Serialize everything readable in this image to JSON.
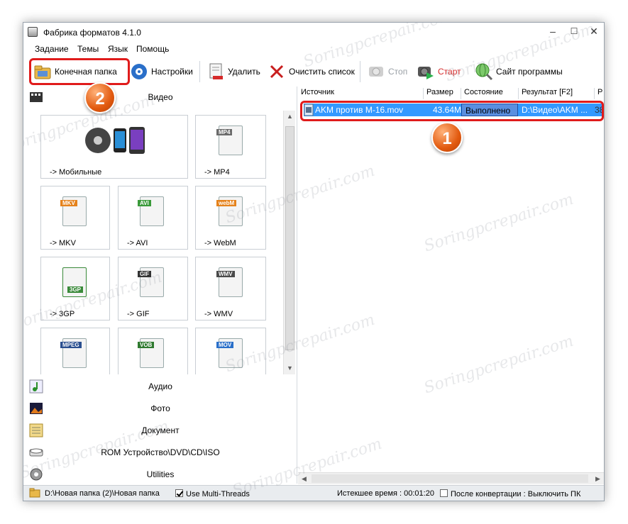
{
  "window": {
    "title": "Фабрика форматов 4.1.0",
    "controls": {
      "minimize": "–",
      "maximize": "☐",
      "close": "✕"
    }
  },
  "menu": [
    "Задание",
    "Темы",
    "Язык",
    "Помощь"
  ],
  "toolbar": {
    "output_folder": "Конечная папка",
    "settings": "Настройки",
    "delete": "Удалить",
    "clear_list": "Очистить список",
    "stop": "Стоп",
    "start": "Старт",
    "website": "Сайт программы"
  },
  "annotations": {
    "badge1": "1",
    "badge2": "2"
  },
  "categories": {
    "video": "Видео",
    "audio": "Аудио",
    "photo": "Фото",
    "document": "Документ",
    "rom": "ROM Устройство\\DVD\\CD\\ISO",
    "utilities": "Utilities"
  },
  "tiles": [
    {
      "label": "-> Мобильные",
      "tag": ""
    },
    {
      "label": "-> MP4",
      "tag": "MP4"
    },
    {
      "label": "-> MKV",
      "tag": "MKV"
    },
    {
      "label": "-> AVI",
      "tag": "AVI"
    },
    {
      "label": "-> WebM",
      "tag": "webM"
    },
    {
      "label": "-> 3GP",
      "tag": "3GP"
    },
    {
      "label": "-> GIF",
      "tag": "GIF"
    },
    {
      "label": "-> WMV",
      "tag": "WMV"
    },
    {
      "label": "",
      "tag": "MPEG"
    },
    {
      "label": "",
      "tag": "VOB"
    },
    {
      "label": "",
      "tag": "MOV"
    }
  ],
  "file_list": {
    "columns": [
      "Источник",
      "Размер",
      "Состояние",
      "Результат [F2]",
      "Р"
    ],
    "rows": [
      {
        "source": "AKM против M-16.mov",
        "size": "43.64M",
        "state": "Выполнено",
        "result": "D:\\Видео\\AKM ...",
        "extra": "38"
      }
    ]
  },
  "statusbar": {
    "output_path": "D:\\Новая папка (2)\\Новая папка",
    "multithreads": "Use Multi-Threads",
    "elapsed": "Истекшее время : 00:01:20",
    "after_conversion": "После конвертации : Выключить ПК"
  },
  "watermark": "Soringpcrepair.com",
  "colors": {
    "selection": "#3399ff",
    "annotation_red": "#e01b1b",
    "badge_orange": "#e25a0f",
    "done_cell": "#3b7ddd"
  }
}
